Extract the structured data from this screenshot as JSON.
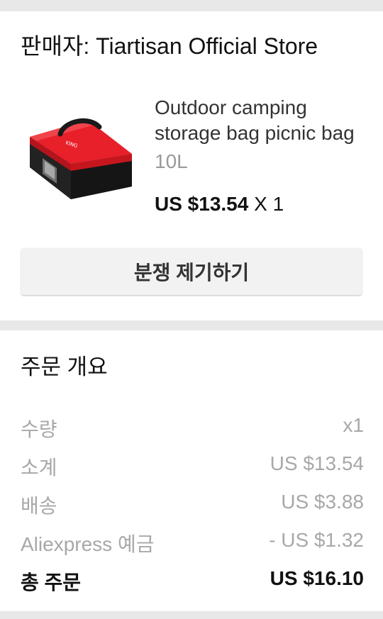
{
  "seller": {
    "title": "판매자: Tiartisan Official Store"
  },
  "product": {
    "title": "Outdoor camping storage bag picnic bag",
    "variant": "10L",
    "price": "US $13.54",
    "quantity": "X 1",
    "image_icon": "red-storage-bag-image"
  },
  "actions": {
    "dispute_label": "분쟁 제기하기"
  },
  "summary": {
    "title": "주문 개요",
    "rows": [
      {
        "label": "수량",
        "value": "x1"
      },
      {
        "label": "소계",
        "value": "US $13.54"
      },
      {
        "label": "배송",
        "value": "US $3.88"
      },
      {
        "label": "Aliexpress 예금",
        "value": "- US $1.32"
      },
      {
        "label": "총 주문",
        "value": "US $16.10"
      }
    ]
  }
}
